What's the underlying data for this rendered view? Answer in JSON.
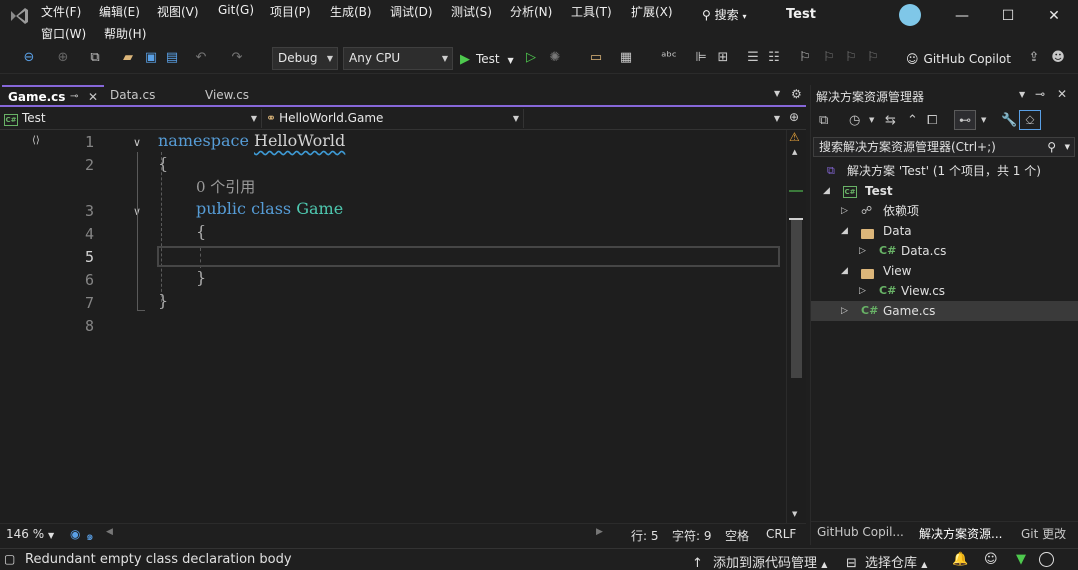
{
  "menu": {
    "row1": [
      "文件(F)",
      "编辑(E)",
      "视图(V)",
      "Git(G)",
      "项目(P)",
      "生成(B)",
      "调试(D)",
      "测试(S)",
      "分析(N)",
      "工具(T)",
      "扩展(X)"
    ],
    "row2": [
      "窗口(W)",
      "帮助(H)"
    ],
    "search": "搜索",
    "app_title": "Test"
  },
  "toolbar": {
    "config": "Debug",
    "platform": "Any CPU",
    "run_label": "Test",
    "copilot": "GitHub Copilot"
  },
  "tabs": [
    {
      "label": "Game.cs",
      "active": true
    },
    {
      "label": "Data.cs",
      "active": false
    },
    {
      "label": "View.cs",
      "active": false
    }
  ],
  "navbar": {
    "project": "Test",
    "type": "HelloWorld.Game"
  },
  "editor": {
    "line_numbers": [
      "1",
      "2",
      "3",
      "4",
      "5",
      "6",
      "7",
      "8"
    ],
    "current_line": "5",
    "kw_namespace": "namespace",
    "ns_name": "HelloWorld",
    "brace_open": "{",
    "brace_close": "}",
    "ref_hint": "0 个引用",
    "kw_public": "public",
    "kw_class": "class",
    "class_name": "Game"
  },
  "editor_status": {
    "zoom": "146 %",
    "line": "行: 5",
    "char": "字符: 9",
    "space": "空格",
    "eol": "CRLF"
  },
  "solution": {
    "header": "解决方案资源管理器",
    "search_placeholder": "搜索解决方案资源管理器(Ctrl+;)",
    "tree": {
      "solution": "解决方案 'Test' (1 个项目，共 1 个)",
      "project": "Test",
      "deps": "依赖项",
      "folder_data": "Data",
      "file_data": "Data.cs",
      "folder_view": "View",
      "file_view": "View.cs",
      "file_game": "Game.cs"
    },
    "bottom_tabs": [
      "GitHub Copil...",
      "解决方案资源...",
      "Git 更改"
    ]
  },
  "statusbar": {
    "message": "Redundant empty class declaration body",
    "source_control": "添加到源代码管理",
    "repo": "选择仓库"
  }
}
